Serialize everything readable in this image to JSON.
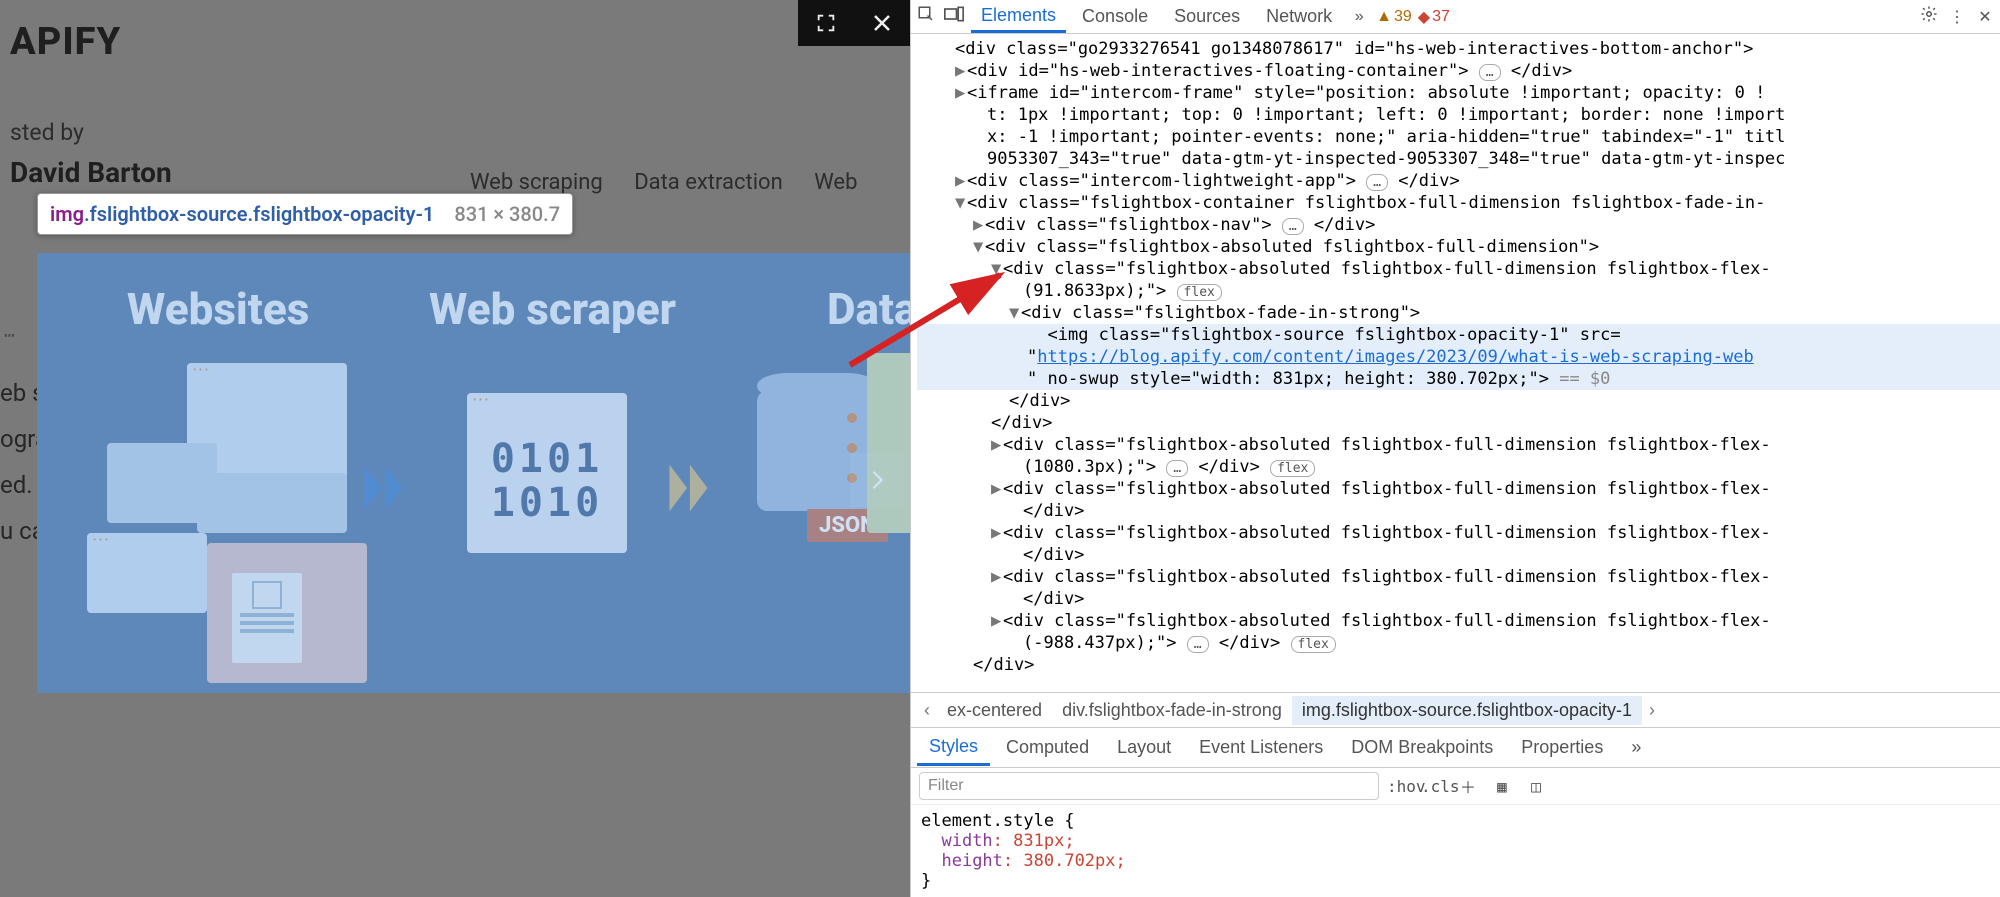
{
  "page": {
    "brand": "APIFY",
    "postedByFragment": "sted by",
    "author": "David Barton",
    "navTags": [
      "Web scraping",
      "Data extraction",
      "Web crawling"
    ],
    "bodyFragments": [
      "eb s",
      "ogra",
      "ed.",
      "u ca"
    ]
  },
  "tooltip": {
    "tag": "img",
    "classes": ".fslightbox-source.fslightbox-opacity-1",
    "dimensions": "831 × 380.7"
  },
  "lightboxLabels": {
    "websites": "Websites",
    "scraper": "Web scraper",
    "data": "Data",
    "scraperCode1": "0101",
    "scraperCode2": "1010",
    "json": "JSON"
  },
  "devtools": {
    "tabs": {
      "elements": "Elements",
      "console": "Console",
      "sources": "Sources",
      "network": "Network"
    },
    "badges": {
      "warnCount": "39",
      "errCount": "37"
    },
    "dom": {
      "l0": "<div class=\"go2933276541 go1348078617\" id=\"hs-web-interactives-bottom-anchor\">",
      "l1a": "<div id=\"hs-web-interactives-floating-container\">",
      "l1b": "</div>",
      "iframeOpen": "<iframe id=\"intercom-frame\" style=\"position: absolute !important; opacity: 0 !",
      "iframeWrap1": "t: 1px !important; top: 0 !important; left: 0 !important; border: none !import",
      "iframeWrap2": "x: -1 !important; pointer-events: none;\" aria-hidden=\"true\" tabindex=\"-1\" titl",
      "iframeWrap3": "9053307_343=\"true\" data-gtm-yt-inspected-9053307_348=\"true\" data-gtm-yt-inspec",
      "l2a": "<div class=\"intercom-lightweight-app\">",
      "l2b": "</div>",
      "l3": "<div class=\"fslightbox-container fslightbox-full-dimension fslightbox-fade-in-",
      "l4a": "<div class=\"fslightbox-nav\">",
      "l4b": "</div>",
      "l5": "<div class=\"fslightbox-absoluted fslightbox-full-dimension\">",
      "l6a": "<div class=\"fslightbox-absoluted fslightbox-full-dimension fslightbox-flex-",
      "l6b": "(91.8633px);\">",
      "l7": "<div class=\"fslightbox-fade-in-strong\">",
      "imgOpen": "<img class=\"fslightbox-source fslightbox-opacity-1\" src=",
      "imgUrl": "https://blog.apify.com/content/images/2023/09/what-is-web-scraping-web",
      "imgClose": "\" no-swup style=\"width: 831px; height: 380.702px;\">",
      "eq0": " == $0",
      "divClose": "</div>",
      "l8": "<div class=\"fslightbox-absoluted fslightbox-full-dimension fslightbox-flex-",
      "l8b": "(1080.3px);\">",
      "l8c": "</div>",
      "l9": "<div class=\"fslightbox-absoluted fslightbox-full-dimension fslightbox-flex-",
      "l10": "<div class=\"fslightbox-absoluted fslightbox-full-dimension fslightbox-flex-",
      "l11": "<div class=\"fslightbox-absoluted fslightbox-full-dimension fslightbox-flex-",
      "l12": "<div class=\"fslightbox-absoluted fslightbox-full-dimension fslightbox-flex-",
      "l12b": "(-988.437px);\">",
      "flex": "flex",
      "dots": "…"
    },
    "crumbs": {
      "c1": "ex-centered",
      "c2": "div.fslightbox-fade-in-strong",
      "c3": "img.fslightbox-source.fslightbox-opacity-1"
    },
    "stylesTabs": {
      "styles": "Styles",
      "computed": "Computed",
      "layout": "Layout",
      "listeners": "Event Listeners",
      "breakpoints": "DOM Breakpoints",
      "properties": "Properties"
    },
    "filterPlaceholder": "Filter",
    "hov": ":hov",
    "cls": ".cls",
    "elementStyle": "element.style {",
    "rule1": {
      "k": "width",
      "v": "831px;"
    },
    "rule2": {
      "k": "height",
      "v": "380.702px;"
    },
    "brace": "}"
  }
}
